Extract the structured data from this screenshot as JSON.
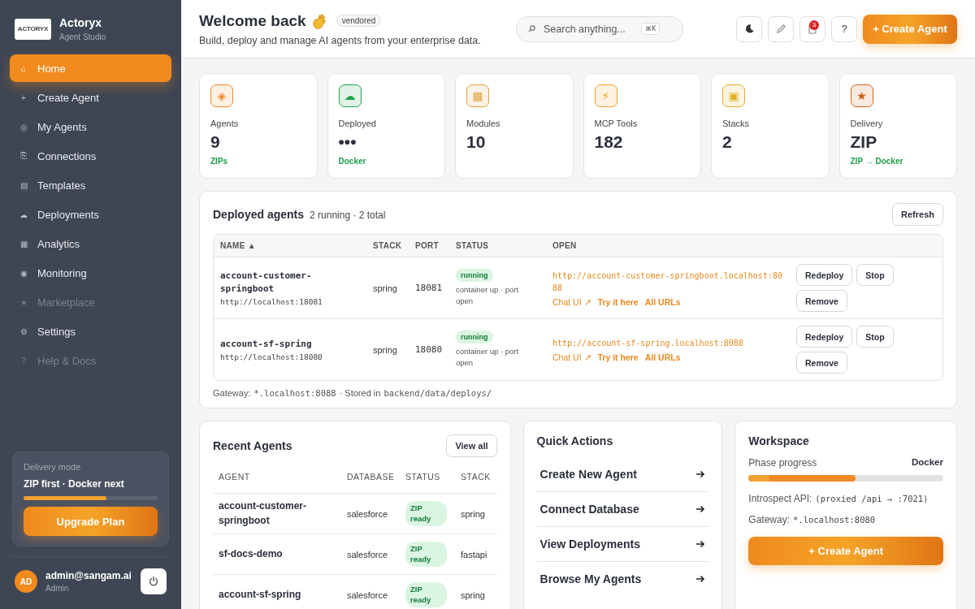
{
  "brand": {
    "logo_text": "ACTORYX",
    "name": "Actoryx",
    "subtitle": "Agent Studio"
  },
  "nav": [
    {
      "icon": "⌂",
      "label": "Home",
      "selected": true,
      "disabled": false
    },
    {
      "icon": "+",
      "label": "Create Agent",
      "selected": false,
      "disabled": false
    },
    {
      "icon": "◎",
      "label": "My Agents",
      "selected": false,
      "disabled": false
    },
    {
      "icon": "⎘",
      "label": "Connections",
      "selected": false,
      "disabled": false
    },
    {
      "icon": "▤",
      "label": "Templates",
      "selected": false,
      "disabled": false
    },
    {
      "icon": "☁",
      "label": "Deployments",
      "selected": false,
      "disabled": false
    },
    {
      "icon": "▦",
      "label": "Analytics",
      "selected": false,
      "disabled": false
    },
    {
      "icon": "◉",
      "label": "Monitoring",
      "selected": false,
      "disabled": false
    },
    {
      "icon": "★",
      "label": "Marketplace",
      "selected": false,
      "disabled": true
    },
    {
      "icon": "⚙",
      "label": "Settings",
      "selected": false,
      "disabled": false
    },
    {
      "icon": "?",
      "label": "Help & Docs",
      "selected": false,
      "disabled": true
    }
  ],
  "plan_card": {
    "label": "Delivery mode",
    "value": "ZIP first · Docker next",
    "level": 0.62,
    "button": "Upgrade Plan"
  },
  "user": {
    "initials": "AD",
    "email": "admin@sangam.ai",
    "role": "Admin"
  },
  "header": {
    "title": "Welcome back",
    "badge": "vendored",
    "subtitle": "Build, deploy and manage AI agents from your enterprise data.",
    "search": {
      "placeholder": "Search anything...",
      "shortcut": "⌘K"
    },
    "help": "?",
    "notifications": "3",
    "create_button": "+ Create Agent"
  },
  "stats": [
    {
      "icon": "◈",
      "color": "#f08a24",
      "label": "Agents",
      "value": "9",
      "note": "ZIPs"
    },
    {
      "icon": "☁",
      "color": "#1fa34a",
      "label": "Deployed",
      "value": "•••",
      "note": "Docker"
    },
    {
      "icon": "▦",
      "color": "#e0a040",
      "label": "Modules",
      "value": "10"
    },
    {
      "icon": "⚡",
      "color": "#f0a020",
      "label": "MCP Tools",
      "value": "182"
    },
    {
      "icon": "▣",
      "color": "#e0b020",
      "label": "Stacks",
      "value": "2"
    },
    {
      "icon": "★",
      "color": "#d06018",
      "label": "Delivery",
      "value": "ZIP",
      "note": "ZIP → Docker"
    }
  ],
  "deployed": {
    "title": "Deployed agents",
    "summary": "2 running · 2 total",
    "refresh": "Refresh",
    "columns": [
      "NAME ▲",
      "STACK",
      "PORT",
      "STATUS",
      "OPEN"
    ],
    "rows": [
      {
        "name": "account-customer-springboot",
        "local_url": "http://localhost:18081",
        "stack": "spring",
        "port": "18081",
        "status": "running",
        "status_note": "container up · port open",
        "url": "http://account-customer-springboot.localhost:8088",
        "links": [
          "Chat UI ↗",
          "Try it here",
          "All URLs"
        ],
        "actions": [
          "Redeploy",
          "Stop",
          "Remove"
        ]
      },
      {
        "name": "account-sf-spring",
        "local_url": "http://localhost:18080",
        "stack": "spring",
        "port": "18080",
        "status": "running",
        "status_note": "container up · port open",
        "url": "http://account-sf-spring.localhost:8088",
        "links": [
          "Chat UI ↗",
          "Try it here",
          "All URLs"
        ],
        "actions": [
          "Redeploy",
          "Stop",
          "Remove"
        ]
      }
    ],
    "footer": {
      "label": "Gateway:",
      "gateway": "*.localhost:8088",
      "middle": "· Stored in",
      "path": "backend/data/deploys/"
    }
  },
  "recent": {
    "title": "Recent Agents",
    "view_all": "View all",
    "columns": [
      "AGENT",
      "DATABASE",
      "STATUS",
      "STACK"
    ],
    "rows": [
      {
        "agent": "account-customer-springboot",
        "database": "salesforce",
        "status": "ZIP ready",
        "stack": "spring"
      },
      {
        "agent": "sf-docs-demo",
        "database": "salesforce",
        "status": "ZIP ready",
        "stack": "fastapi"
      },
      {
        "agent": "account-sf-spring",
        "database": "salesforce",
        "status": "ZIP ready",
        "stack": "spring"
      }
    ]
  },
  "quick_actions": {
    "title": "Quick Actions",
    "items": [
      "Create New Agent",
      "Connect Database",
      "View Deployments",
      "Browse My Agents"
    ]
  },
  "workspace": {
    "title": "Workspace",
    "progress_label": "Phase progress",
    "phase": "Docker",
    "level": 0.55,
    "api_label": "Introspect API:",
    "api_value": "(proxied /api → :7021)",
    "gateway_label": "Gateway:",
    "gateway_value": "*.localhost:8080",
    "button": "+ Create Agent"
  }
}
